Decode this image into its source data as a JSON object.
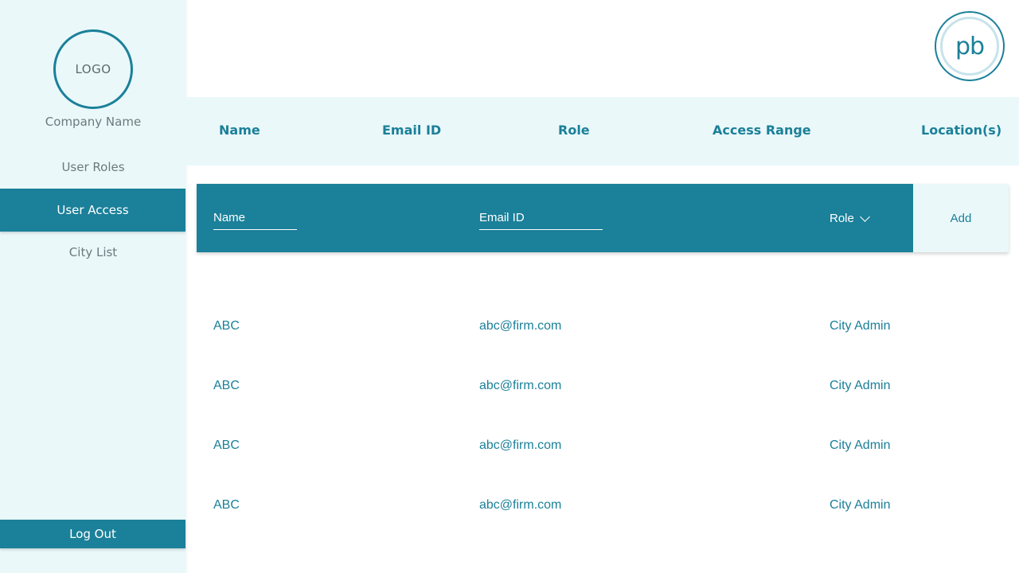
{
  "sidebar": {
    "logo_text": "LOGO",
    "company_name": "Company Name",
    "items": [
      {
        "label": "User Roles"
      },
      {
        "label": "User Access"
      },
      {
        "label": "City List"
      }
    ],
    "logout_label": "Log Out"
  },
  "avatar": {
    "initials": "pb"
  },
  "table": {
    "columns": [
      "Name",
      "Email ID",
      "Role",
      "Access Range",
      "Location(s)"
    ],
    "rows": [
      {
        "name": "ABC",
        "email": "abc@firm.com",
        "role": "City Admin"
      },
      {
        "name": "ABC",
        "email": "abc@firm.com",
        "role": "City Admin"
      },
      {
        "name": "ABC",
        "email": "abc@firm.com",
        "role": "City Admin"
      },
      {
        "name": "ABC",
        "email": "abc@firm.com",
        "role": "City Admin"
      }
    ]
  },
  "add_form": {
    "name_placeholder": "Name",
    "email_placeholder": "Email ID",
    "role_label": "Role",
    "add_label": "Add"
  },
  "colors": {
    "accent": "#1b8099",
    "sidebar_bg": "#eaf8fa"
  }
}
